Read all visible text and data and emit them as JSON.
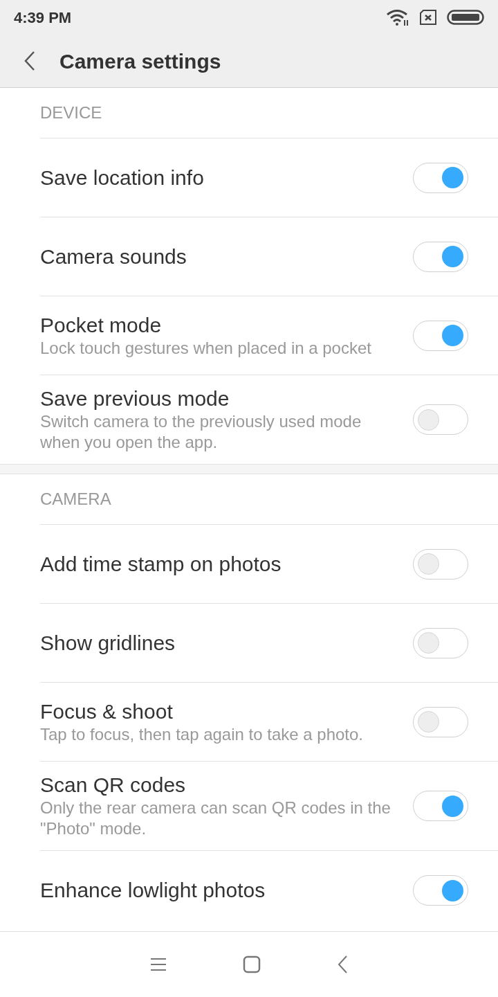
{
  "status_bar": {
    "time": "4:39 PM"
  },
  "header": {
    "title": "Camera settings"
  },
  "sections": [
    {
      "title": "DEVICE",
      "items": [
        {
          "title": "Save location info",
          "on": true
        },
        {
          "title": "Camera sounds",
          "on": true
        },
        {
          "title": "Pocket mode",
          "subtitle": "Lock touch gestures when placed in a pocket",
          "on": true
        },
        {
          "title": "Save previous mode",
          "subtitle": "Switch camera to the previously used mode when you open the app.",
          "on": false
        }
      ]
    },
    {
      "title": "CAMERA",
      "items": [
        {
          "title": "Add time stamp on photos",
          "on": false
        },
        {
          "title": "Show gridlines",
          "on": false
        },
        {
          "title": "Focus & shoot",
          "subtitle": "Tap to focus, then tap again to take a photo.",
          "on": false
        },
        {
          "title": "Scan QR codes",
          "subtitle": "Only the rear camera can scan QR codes in the \"Photo\" mode.",
          "on": true
        },
        {
          "title": "Enhance lowlight photos",
          "on": true
        }
      ]
    }
  ]
}
